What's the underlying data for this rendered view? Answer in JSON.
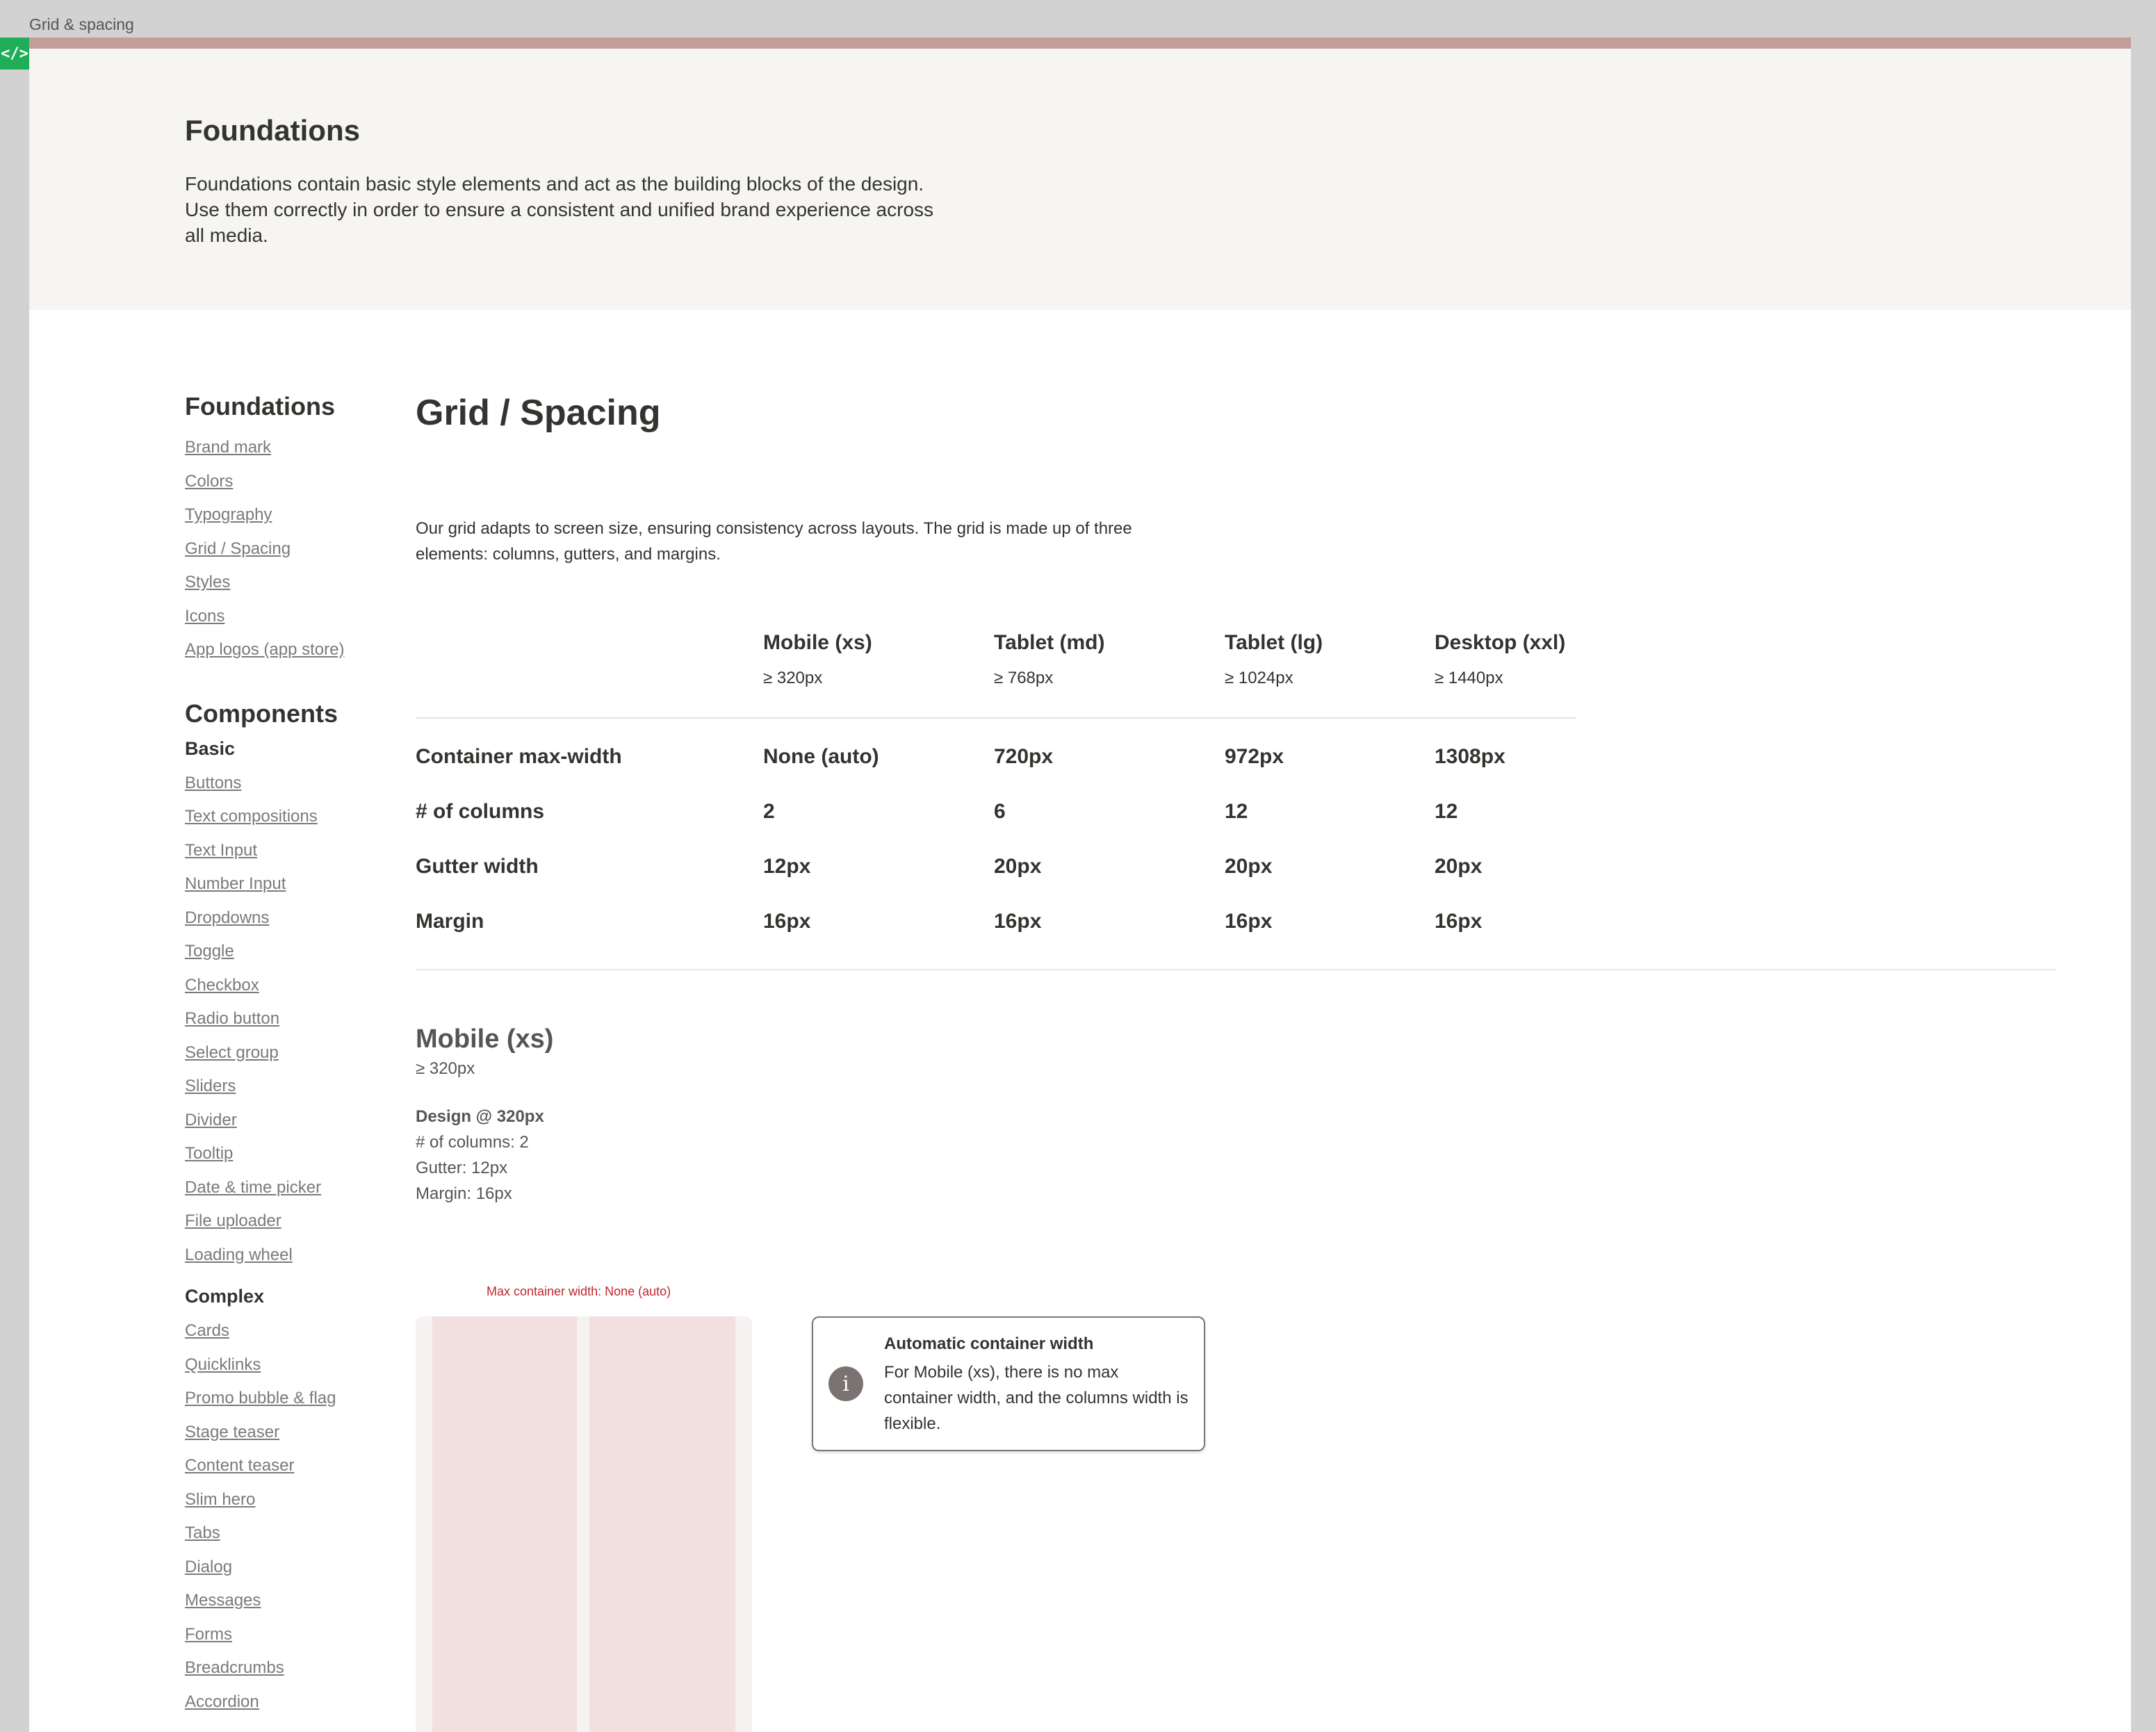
{
  "window": {
    "title": "Grid & spacing",
    "code_badge": "</>"
  },
  "hero": {
    "title": "Foundations",
    "description": "Foundations contain basic style elements and act as the building blocks of the design. Use them correctly in order to ensure a consistent and unified brand experience across all media."
  },
  "sidebar": {
    "foundations_heading": "Foundations",
    "foundations_links": [
      "Brand mark",
      "Colors",
      "Typography",
      "Grid / Spacing",
      "Styles",
      "Icons",
      "App logos (app store)"
    ],
    "components_heading": "Components",
    "basic_heading": "Basic",
    "basic_links": [
      "Buttons",
      "Text compositions",
      "Text Input",
      "Number Input",
      "Dropdowns",
      "Toggle",
      "Checkbox",
      "Radio button",
      "Select group",
      "Sliders",
      "Divider",
      "Tooltip",
      "Date & time picker",
      "File uploader",
      "Loading wheel"
    ],
    "complex_heading": "Complex",
    "complex_links": [
      "Cards",
      "Quicklinks",
      "Promo bubble & flag",
      "Stage teaser",
      "Content teaser",
      "Slim hero",
      "Tabs",
      "Dialog",
      "Messages",
      "Forms",
      "Breadcrumbs",
      "Accordion"
    ]
  },
  "main": {
    "title": "Grid / Spacing",
    "intro": "Our grid adapts to screen size, ensuring consistency across layouts. The grid is made up of three elements: columns, gutters, and margins.",
    "table": {
      "breakpoints": [
        {
          "name": "Mobile (xs)",
          "min": "≥ 320px"
        },
        {
          "name": "Tablet (md)",
          "min": "≥ 768px"
        },
        {
          "name": "Tablet (lg)",
          "min": "≥ 1024px"
        },
        {
          "name": "Desktop (xxl)",
          "min": "≥ 1440px"
        }
      ],
      "rows": [
        {
          "label": "Container max-width",
          "values": [
            "None (auto)",
            "720px",
            "972px",
            "1308px"
          ]
        },
        {
          "label": "# of columns",
          "values": [
            "2",
            "6",
            "12",
            "12"
          ]
        },
        {
          "label": "Gutter width",
          "values": [
            "12px",
            "20px",
            "20px",
            "20px"
          ]
        },
        {
          "label": "Margin",
          "values": [
            "16px",
            "16px",
            "16px",
            "16px"
          ]
        }
      ]
    },
    "mobile_section": {
      "title": "Mobile (xs)",
      "subtitle": "≥ 320px",
      "design_title": "Design @ 320px",
      "columns_line": "# of columns: 2",
      "gutter_line": "Gutter: 12px",
      "margin_line": "Margin: 16px",
      "max_width_label": "Max container width: None (auto)",
      "info_title": "Automatic container width",
      "info_body": "For Mobile (xs), there is no max container width, and the columns width is flexible.",
      "info_icon": "info-icon"
    }
  }
}
